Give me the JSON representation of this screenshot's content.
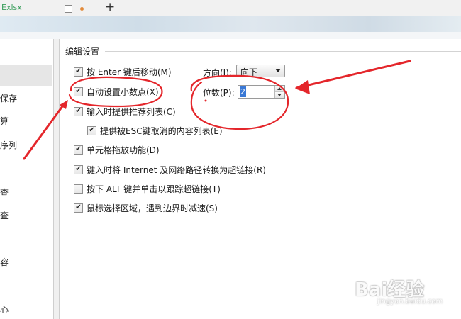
{
  "tab": {
    "title": "Exlsx"
  },
  "nav": {
    "items": [
      "保存",
      "算",
      "序列",
      "查",
      "查",
      "容",
      "心"
    ]
  },
  "group": {
    "title": "编辑设置",
    "options": [
      {
        "label": "按 Enter 键后移动(M)",
        "checked": true
      },
      {
        "label": "自动设置小数点(X)",
        "checked": true
      },
      {
        "label": "输入时提供推荐列表(C)",
        "checked": true
      },
      {
        "label": "提供被ESC键取消的内容列表(E)",
        "checked": true
      },
      {
        "label": "单元格拖放功能(D)",
        "checked": true
      },
      {
        "label": "键入时将 Internet 及网络路径转换为超链接(R)",
        "checked": true
      },
      {
        "label": "按下 ALT 键并单击以跟踪超链接(T)",
        "checked": false
      },
      {
        "label": "鼠标选择区域，遇到边界时减速(S)",
        "checked": true
      }
    ],
    "direction_label": "方向(I):",
    "direction_value": "向下",
    "places_label": "位数(P):",
    "places_value": "2"
  },
  "annotation": {
    "color": "#e4262b"
  },
  "watermark": {
    "brand": "Bai经验",
    "url": "jingyan.baidu.com"
  }
}
